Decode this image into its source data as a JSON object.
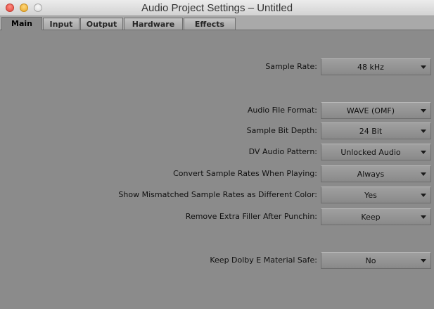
{
  "window": {
    "title": "Audio Project Settings – Untitled"
  },
  "tabs": [
    {
      "label": "Main",
      "active": true
    },
    {
      "label": "Input",
      "active": false
    },
    {
      "label": "Output",
      "active": false
    },
    {
      "label": "Hardware",
      "active": false
    },
    {
      "label": "Effects",
      "active": false
    }
  ],
  "settings": [
    {
      "label": "Sample Rate:",
      "value": "48 kHz"
    },
    {
      "label": "Audio File Format:",
      "value": "WAVE (OMF)"
    },
    {
      "label": "Sample Bit Depth:",
      "value": "24 Bit"
    },
    {
      "label": "DV Audio Pattern:",
      "value": "Unlocked Audio"
    },
    {
      "label": "Convert Sample Rates When Playing:",
      "value": "Always"
    },
    {
      "label": "Show Mismatched Sample Rates as Different Color:",
      "value": "Yes"
    },
    {
      "label": "Remove Extra Filler After Punchin:",
      "value": "Keep"
    },
    {
      "label": "Keep Dolby E Material Safe:",
      "value": "No"
    }
  ]
}
